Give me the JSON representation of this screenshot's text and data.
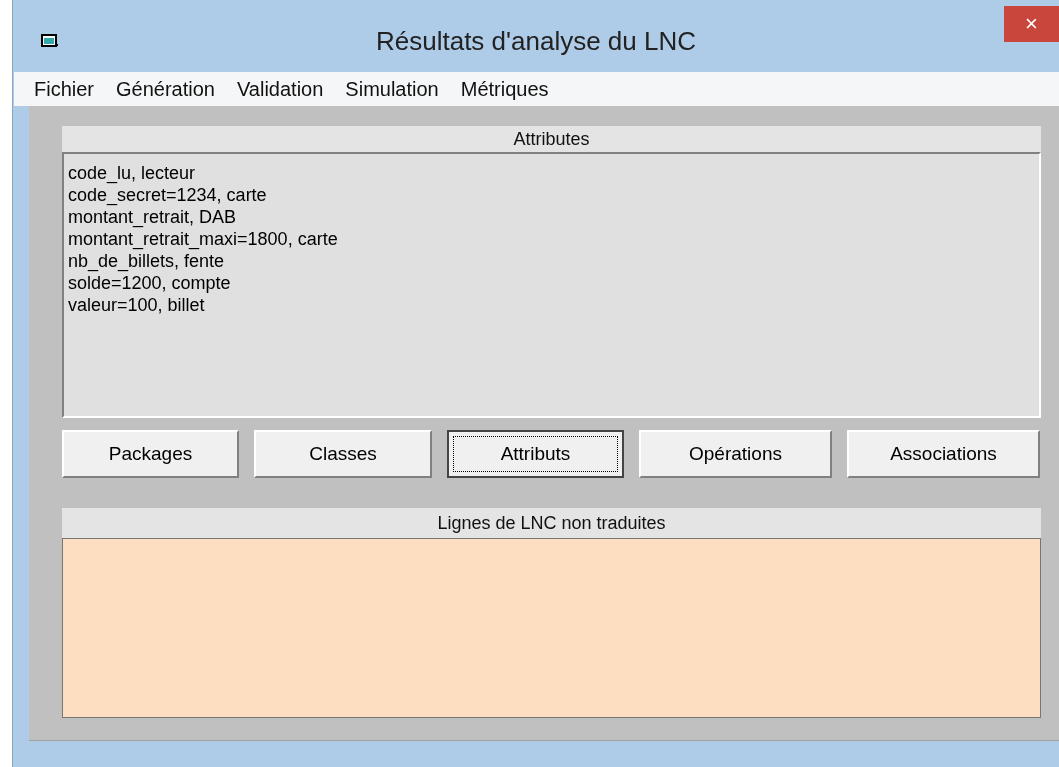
{
  "window": {
    "title": "Résultats d'analyse du LNC",
    "close": "×"
  },
  "menu": [
    "Fichier",
    "Génération",
    "Validation",
    "Simulation",
    "Métriques"
  ],
  "top_panel": {
    "title": "Attributes",
    "lines": [
      "code_lu, lecteur",
      "code_secret=1234, carte",
      "montant_retrait, DAB",
      "montant_retrait_maxi=1800, carte",
      "nb_de_billets, fente",
      "solde=1200, compte",
      "valeur=100, billet"
    ]
  },
  "buttons": [
    {
      "label": "Packages",
      "selected": false
    },
    {
      "label": "Classes",
      "selected": false
    },
    {
      "label": "Attributs",
      "selected": true
    },
    {
      "label": "Opérations",
      "selected": false
    },
    {
      "label": "Associations",
      "selected": false
    }
  ],
  "bottom_panel": {
    "title": "Lignes de LNC non traduites"
  }
}
